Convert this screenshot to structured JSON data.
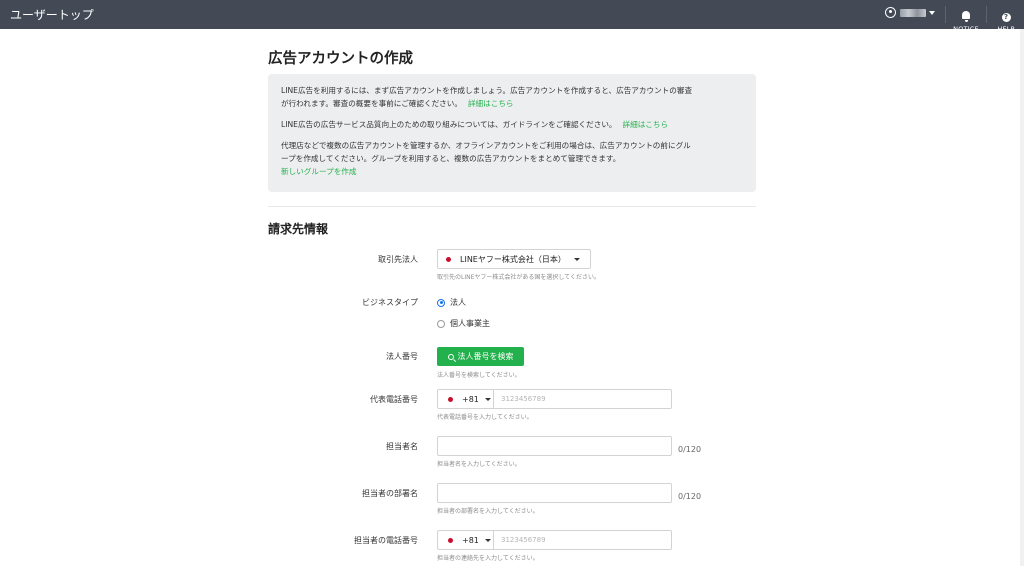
{
  "topbar": {
    "home_label": "ユーザートップ",
    "notice_label": "NOTICE",
    "help_label": "HELP",
    "help_glyph": "?"
  },
  "page": {
    "title": "広告アカウントの作成"
  },
  "info": {
    "p1_line1": "LINE広告を利用するには、まず広告アカウントを作成しましょう。広告アカウントを作成すると、広告アカウントの審査",
    "p1_line2": "が行われます。審査の概要を事前にご確認ください。",
    "p1_link": "詳細はこちら",
    "p2_text": "LINE広告の広告サービス品質向上のための取り組みについては、ガイドラインをご確認ください。",
    "p2_link": "詳細はこちら",
    "p3_line1": "代理店などで複数の広告アカウントを管理するか、オフラインアカウントをご利用の場合は、広告アカウントの前にグル",
    "p3_line2": "ープを作成してください。グループを利用すると、複数の広告アカウントをまとめて管理できます。",
    "p3_link": "新しいグループを作成"
  },
  "billing": {
    "section_title": "請求先情報",
    "entity": {
      "label": "取引先法人",
      "value": "LINEヤフー株式会社（日本）",
      "help": "取引先のLINEヤフー株式会社がある国を選択してください。"
    },
    "business_type": {
      "label": "ビジネスタイプ",
      "options": [
        "法人",
        "個人事業主"
      ],
      "selected": "法人"
    },
    "corp_number": {
      "label": "法人番号",
      "button": "法人番号を検索",
      "help": "法人番号を検索してください。"
    },
    "rep_phone": {
      "label": "代表電話番号",
      "code": "+81",
      "placeholder": "3123456789",
      "help": "代表電話番号を入力してください。"
    },
    "contact_name": {
      "label": "担当者名",
      "value": "",
      "counter": "0/120",
      "help": "担当者名を入力してください。"
    },
    "contact_dept": {
      "label": "担当者の部署名",
      "value": "",
      "counter": "0/120",
      "help": "担当者の部署名を入力してください。"
    },
    "contact_phone": {
      "label": "担当者の電話番号",
      "code": "+81",
      "placeholder": "3123456789",
      "help": "担当者の連絡先を入力してください。"
    }
  },
  "colors": {
    "topbar": "#434a56",
    "accent_green": "#23b14d",
    "link_green": "#22b14c",
    "radio_blue": "#1a73e8",
    "flag_red": "#c8102e"
  }
}
